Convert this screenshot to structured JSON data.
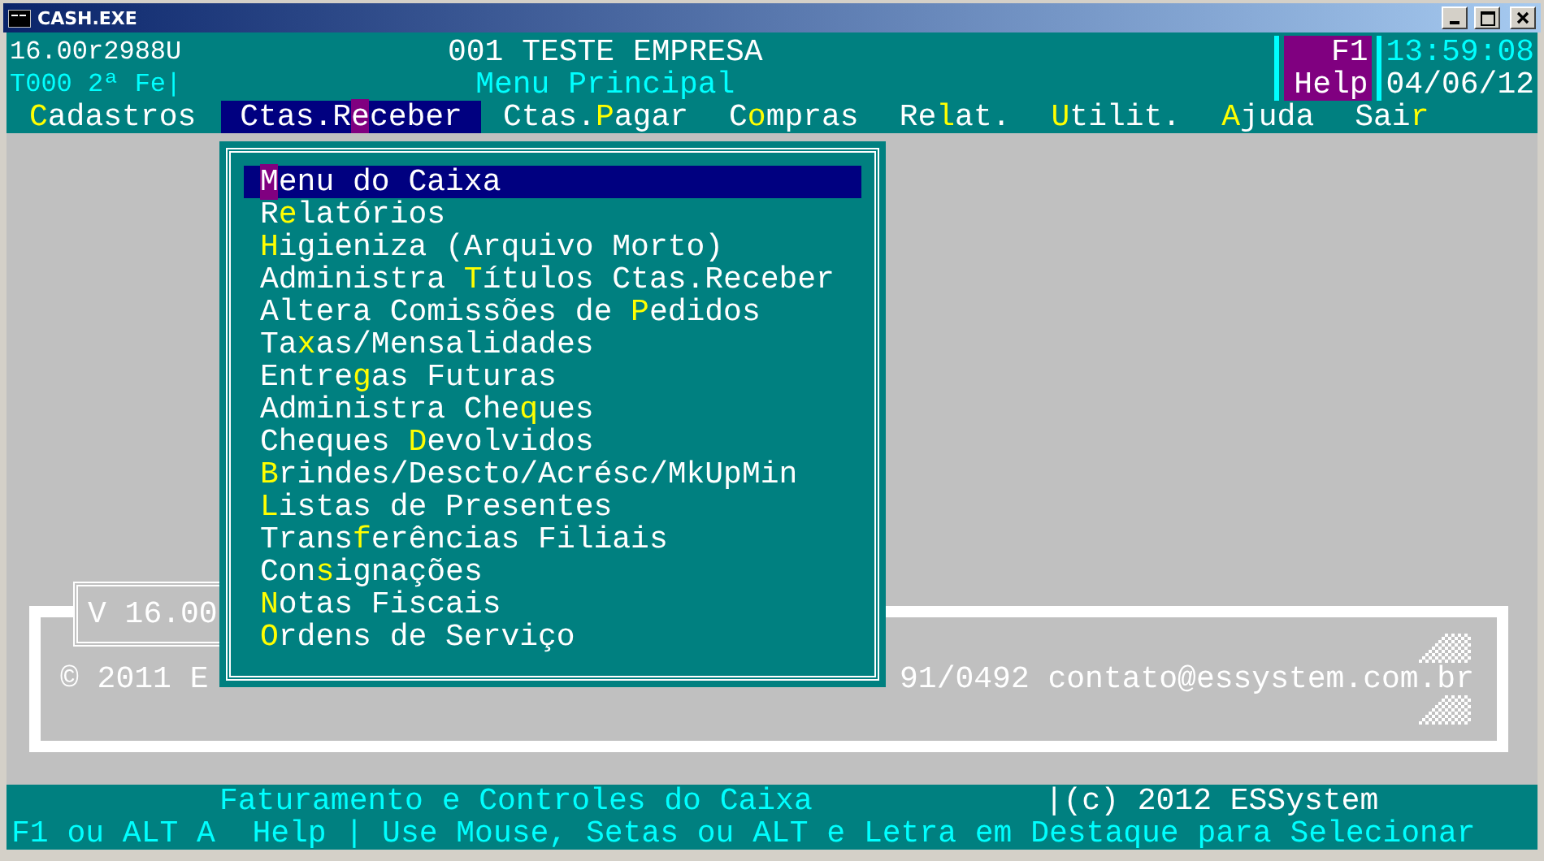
{
  "window": {
    "title": "CASH.EXE"
  },
  "header": {
    "build": "16.00r2988U",
    "company": "001 TESTE EMPRESA",
    "terminal": "T000 2ª Fe|",
    "screen": "Menu Principal",
    "help_key": "F1",
    "help_label": "Help",
    "time": "13:59:08",
    "date": "04/06/12"
  },
  "menu_bar": [
    {
      "key": "C",
      "post": "adastros",
      "selected": false
    },
    {
      "pre": "Ctas.R",
      "key": "e",
      "post": "ceber",
      "selected": true
    },
    {
      "pre": "Ctas.",
      "key": "P",
      "post": "agar",
      "selected": false
    },
    {
      "pre": "C",
      "key": "o",
      "post": "mpras",
      "selected": false
    },
    {
      "pre": "Re",
      "key": "l",
      "post": "at.",
      "selected": false
    },
    {
      "key": "U",
      "post": "tilit.",
      "selected": false
    },
    {
      "key": "A",
      "post": "juda",
      "selected": false
    },
    {
      "pre": "Sai",
      "key": "r",
      "selected": false
    }
  ],
  "dropdown": {
    "items": [
      {
        "key": "M",
        "post": "enu do Caixa",
        "selected": true
      },
      {
        "pre": "R",
        "key": "e",
        "post": "latórios",
        "selected": false
      },
      {
        "key": "H",
        "post": "igieniza (Arquivo Morto)",
        "selected": false
      },
      {
        "pre": "Administra ",
        "key": "T",
        "post": "ítulos Ctas.Receber",
        "selected": false
      },
      {
        "pre": "Altera Comissões de ",
        "key": "P",
        "post": "edidos",
        "selected": false
      },
      {
        "pre": "Ta",
        "key": "x",
        "post": "as/Mensalidades",
        "selected": false
      },
      {
        "pre": "Entre",
        "key": "g",
        "post": "as Futuras",
        "selected": false
      },
      {
        "pre": "Administra Che",
        "key": "q",
        "post": "ues",
        "selected": false
      },
      {
        "pre": "Cheques ",
        "key": "D",
        "post": "evolvidos",
        "selected": false
      },
      {
        "key": "B",
        "post": "rindes/Descto/Acrésc/MkUpMin",
        "selected": false
      },
      {
        "key": "L",
        "post": "istas de Presentes",
        "selected": false
      },
      {
        "pre": "Trans",
        "key": "f",
        "post": "erências Filiais",
        "selected": false
      },
      {
        "pre": "Con",
        "key": "s",
        "post": "ignações",
        "selected": false
      },
      {
        "key": "N",
        "post": "otas Fiscais",
        "selected": false
      },
      {
        "key": "O",
        "post": "rdens de Serviço",
        "selected": false
      }
    ]
  },
  "background": {
    "version": "V 16.00",
    "copyright": "© 2011 E",
    "contact": "91/0492 contato@essystem.com.br"
  },
  "status_bar": {
    "description": "Faturamento e Controles do Caixa",
    "copyright": "|(c) 2012 ESSystem",
    "hint": "F1 ou ALT A  Help | Use Mouse, Setas ou ALT e Letra em Destaque para Selecionar"
  }
}
